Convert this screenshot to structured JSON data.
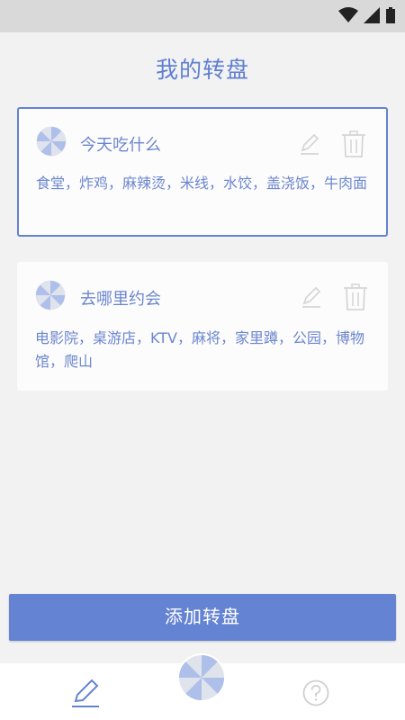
{
  "title": "我的转盘",
  "colors": {
    "accent": "#6583d3",
    "text": "#6a86cf",
    "background": "#f2f2f3"
  },
  "cards": [
    {
      "name": "今天吃什么",
      "items": "食堂，炸鸡，麻辣烫，米线，水饺，盖浇饭，牛肉面",
      "selected": true
    },
    {
      "name": "去哪里约会",
      "items": "电影院，桌游店，KTV，麻将，家里蹲，公园，博物馆，爬山",
      "selected": false
    }
  ],
  "add_button_label": "添加转盘",
  "bottom_nav": {
    "icons": [
      "edit-icon",
      "wheel-icon",
      "help-icon"
    ]
  }
}
